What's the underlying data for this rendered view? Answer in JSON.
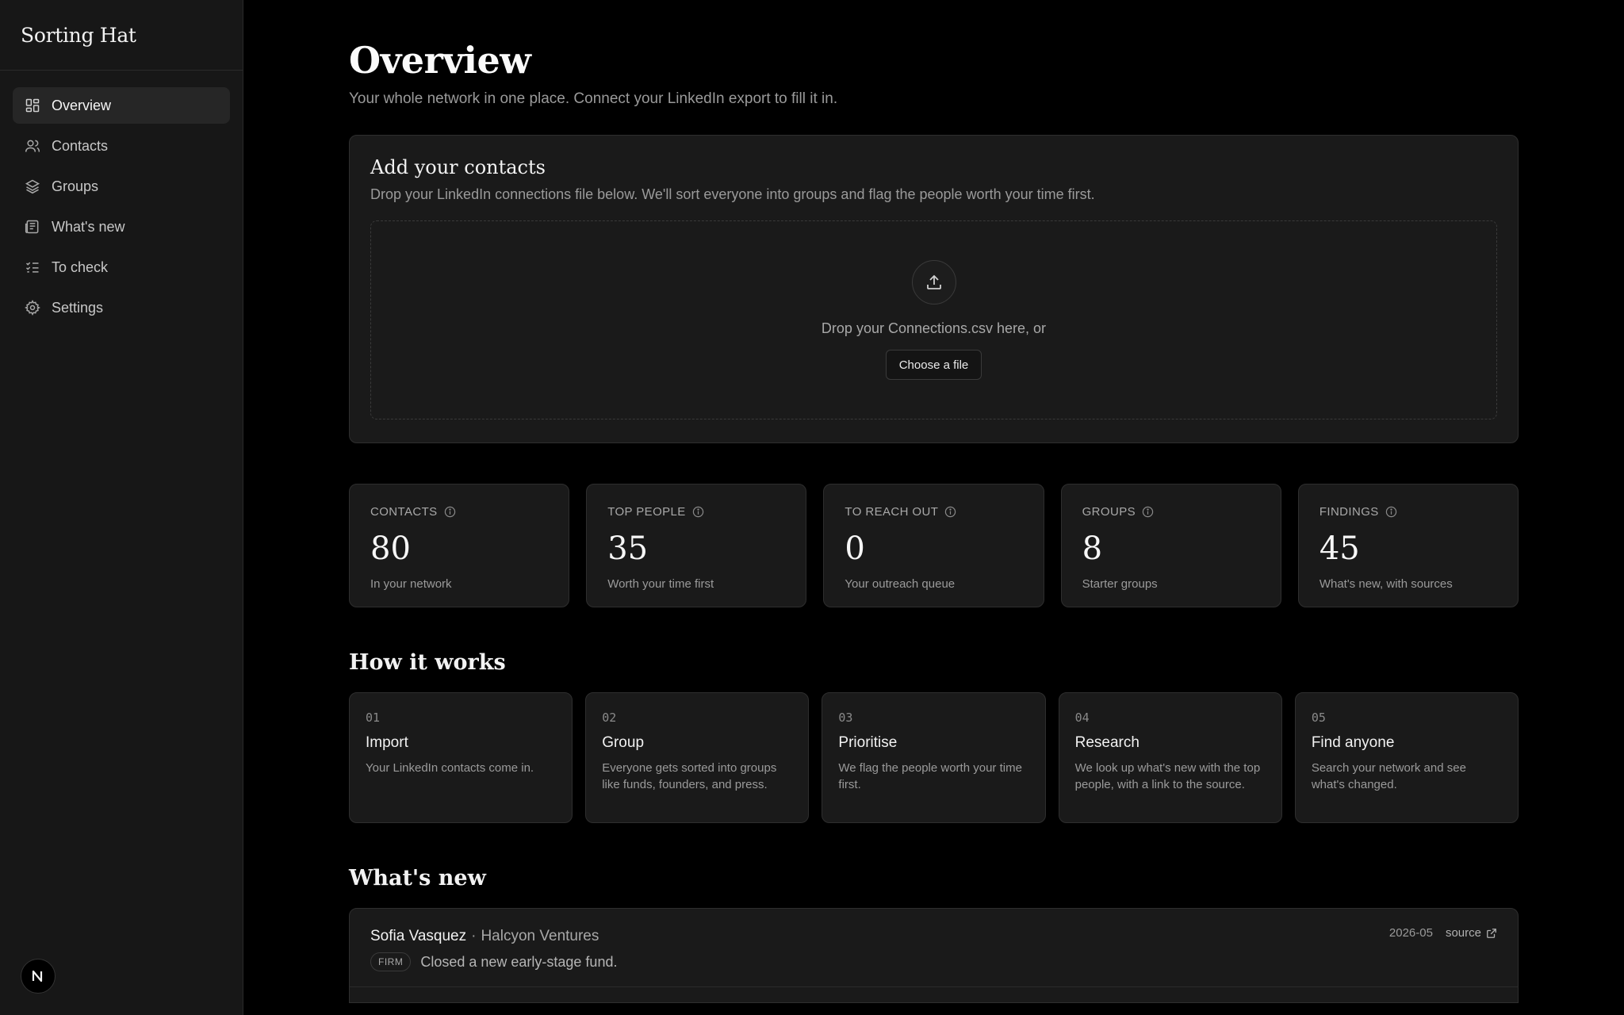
{
  "app": {
    "title": "Sorting Hat"
  },
  "sidebar": {
    "items": [
      {
        "label": "Overview",
        "icon": "grid-icon",
        "active": true
      },
      {
        "label": "Contacts",
        "icon": "users-icon"
      },
      {
        "label": "Groups",
        "icon": "layers-icon"
      },
      {
        "label": "What's new",
        "icon": "newspaper-icon"
      },
      {
        "label": "To check",
        "icon": "checklist-icon"
      },
      {
        "label": "Settings",
        "icon": "gear-icon"
      }
    ],
    "avatar_letter": "N"
  },
  "header": {
    "title": "Overview",
    "subtitle": "Your whole network in one place. Connect your LinkedIn export to fill it in."
  },
  "import": {
    "title": "Add your contacts",
    "subtitle": "Drop your LinkedIn connections file below. We'll sort everyone into groups and flag the people worth your time first.",
    "drop_text": "Drop your Connections.csv here, or",
    "button_label": "Choose a file"
  },
  "stats": [
    {
      "label": "CONTACTS",
      "value": "80",
      "sub": "In your network"
    },
    {
      "label": "TOP PEOPLE",
      "value": "35",
      "sub": "Worth your time first"
    },
    {
      "label": "TO REACH OUT",
      "value": "0",
      "sub": "Your outreach queue"
    },
    {
      "label": "GROUPS",
      "value": "8",
      "sub": "Starter groups"
    },
    {
      "label": "FINDINGS",
      "value": "45",
      "sub": "What's new, with sources"
    }
  ],
  "how_it_works": {
    "title": "How it works",
    "steps": [
      {
        "num": "01",
        "name": "Import",
        "desc": "Your LinkedIn contacts come in."
      },
      {
        "num": "02",
        "name": "Group",
        "desc": "Everyone gets sorted into groups like funds, founders, and press."
      },
      {
        "num": "03",
        "name": "Prioritise",
        "desc": "We flag the people worth your time first."
      },
      {
        "num": "04",
        "name": "Research",
        "desc": "We look up what's new with the top people, with a link to the source."
      },
      {
        "num": "05",
        "name": "Find anyone",
        "desc": "Search your network and see what's changed."
      }
    ]
  },
  "whats_new": {
    "title": "What's new",
    "items": [
      {
        "name": "Sofia Vasquez",
        "separator": "·",
        "org": "Halcyon Ventures",
        "badge": "FIRM",
        "text": "Closed a new early-stage fund.",
        "date": "2026-05",
        "source_label": "source"
      }
    ]
  },
  "colors": {
    "background": "#000000",
    "sidebar": "#171717",
    "card": "#1a1a1a",
    "border": "#2e2e2e",
    "text": "#f2f2f2",
    "muted": "#9a9a9a"
  }
}
